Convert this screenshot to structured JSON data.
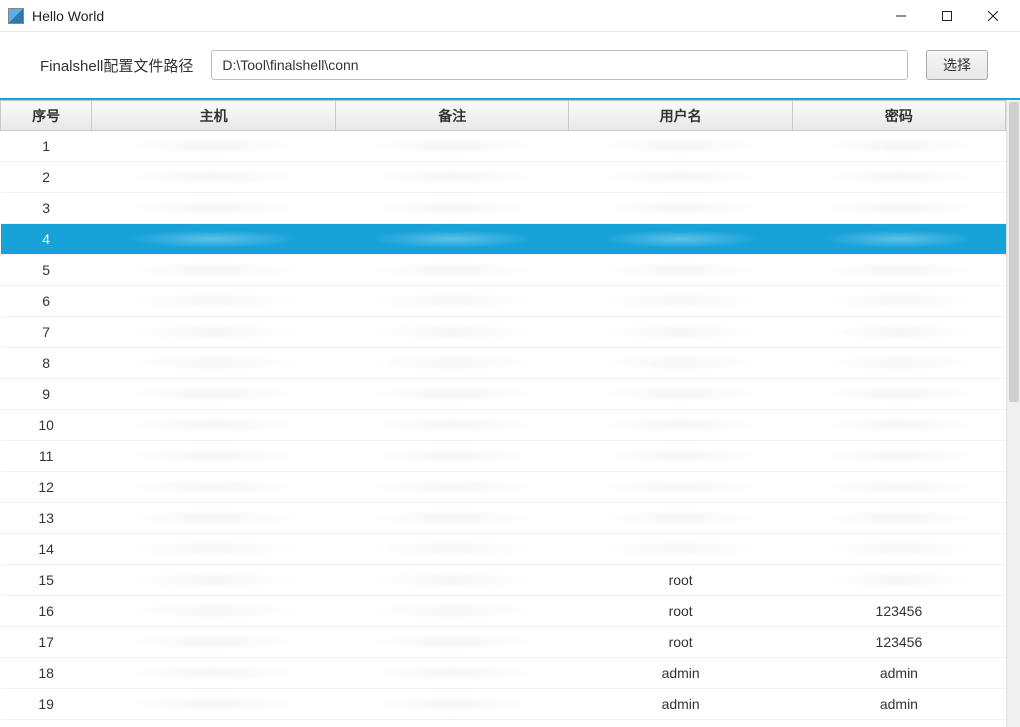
{
  "window": {
    "title": "Hello World"
  },
  "toolbar": {
    "path_label": "Finalshell配置文件路径",
    "path_value": "D:\\Tool\\finalshell\\conn",
    "choose_label": "选择"
  },
  "table": {
    "columns": [
      "序号",
      "主机",
      "备注",
      "用户名",
      "密码"
    ],
    "selected_index": 3,
    "rows": [
      {
        "seq": "1",
        "host": "",
        "note": "",
        "user": "",
        "pass": ""
      },
      {
        "seq": "2",
        "host": "",
        "note": "",
        "user": "",
        "pass": ""
      },
      {
        "seq": "3",
        "host": "",
        "note": "",
        "user": "",
        "pass": ""
      },
      {
        "seq": "4",
        "host": "",
        "note": "",
        "user": "",
        "pass": ""
      },
      {
        "seq": "5",
        "host": "",
        "note": "",
        "user": "",
        "pass": ""
      },
      {
        "seq": "6",
        "host": "",
        "note": "",
        "user": "",
        "pass": ""
      },
      {
        "seq": "7",
        "host": "",
        "note": "",
        "user": "",
        "pass": ""
      },
      {
        "seq": "8",
        "host": "",
        "note": "",
        "user": "",
        "pass": ""
      },
      {
        "seq": "9",
        "host": "",
        "note": "",
        "user": "",
        "pass": ""
      },
      {
        "seq": "10",
        "host": "",
        "note": "",
        "user": "",
        "pass": ""
      },
      {
        "seq": "11",
        "host": "",
        "note": "",
        "user": "",
        "pass": ""
      },
      {
        "seq": "12",
        "host": "",
        "note": "",
        "user": "",
        "pass": ""
      },
      {
        "seq": "13",
        "host": "",
        "note": "",
        "user": "",
        "pass": ""
      },
      {
        "seq": "14",
        "host": "",
        "note": "",
        "user": "",
        "pass": ""
      },
      {
        "seq": "15",
        "host": "",
        "note": "",
        "user": "root",
        "pass": ""
      },
      {
        "seq": "16",
        "host": "",
        "note": "",
        "user": "root",
        "pass": "123456"
      },
      {
        "seq": "17",
        "host": "",
        "note": "",
        "user": "root",
        "pass": "123456"
      },
      {
        "seq": "18",
        "host": "",
        "note": "",
        "user": "admin",
        "pass": "admin"
      },
      {
        "seq": "19",
        "host": "",
        "note": "",
        "user": "admin",
        "pass": "admin"
      }
    ]
  }
}
